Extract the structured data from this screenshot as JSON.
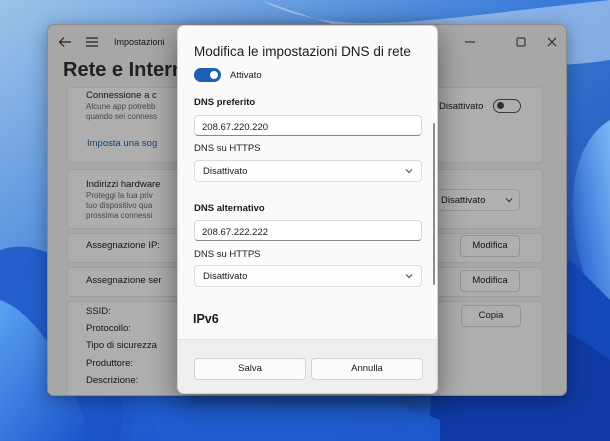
{
  "colors": {
    "accent": "#1f5fb8",
    "link": "#1f5fad",
    "wallpaper": "#2b63c9"
  },
  "window": {
    "title": "Impostazioni",
    "heading": "Rete e Interne",
    "heading_tail": ")",
    "icons": [
      "back-arrow-icon",
      "hamburger-menu-icon",
      "minimize-icon",
      "maximize-icon",
      "close-icon"
    ]
  },
  "background_rows": {
    "connection_title": "Connessione a c",
    "connection_desc_1": "Alcune app potrebb",
    "connection_desc_2": "quando sei conness",
    "metered_toggle_label": "Disattivato",
    "data_limit_link": "Imposta una sog",
    "hw_address_title": "Indirizzi hardware",
    "hw_address_desc_1": "Proteggi la tua priv",
    "hw_address_desc_2": "tuo dispositivo qua",
    "hw_address_desc_3": "prossima connessi",
    "hw_address_select": "Disattivato",
    "ip_assignment_label": "Assegnazione IP:",
    "ip_assignment_button": "Modifica",
    "dns_assignment_label": "Assegnazione ser",
    "dns_assignment_button": "Modifica",
    "ssid_label": "SSID:",
    "protocol_label": "Protocollo:",
    "security_label": "Tipo di sicurezza",
    "manufacturer_label": "Produttore:",
    "description_label": "Descrizione:",
    "copy_button": "Copia"
  },
  "dialog": {
    "title": "Modifica le impostazioni DNS di rete",
    "ipv4_toggle_label": "Attivato",
    "preferred_dns_label": "DNS preferito",
    "preferred_dns_value": "208.67.220.220",
    "preferred_https_label": "DNS su HTTPS",
    "preferred_https_value": "Disattivato",
    "alternate_dns_label": "DNS alternativo",
    "alternate_dns_value": "208.67.222.222",
    "alternate_https_label": "DNS su HTTPS",
    "alternate_https_value": "Disattivato",
    "ipv6_section": "IPv6",
    "save_button": "Salva",
    "cancel_button": "Annulla"
  }
}
